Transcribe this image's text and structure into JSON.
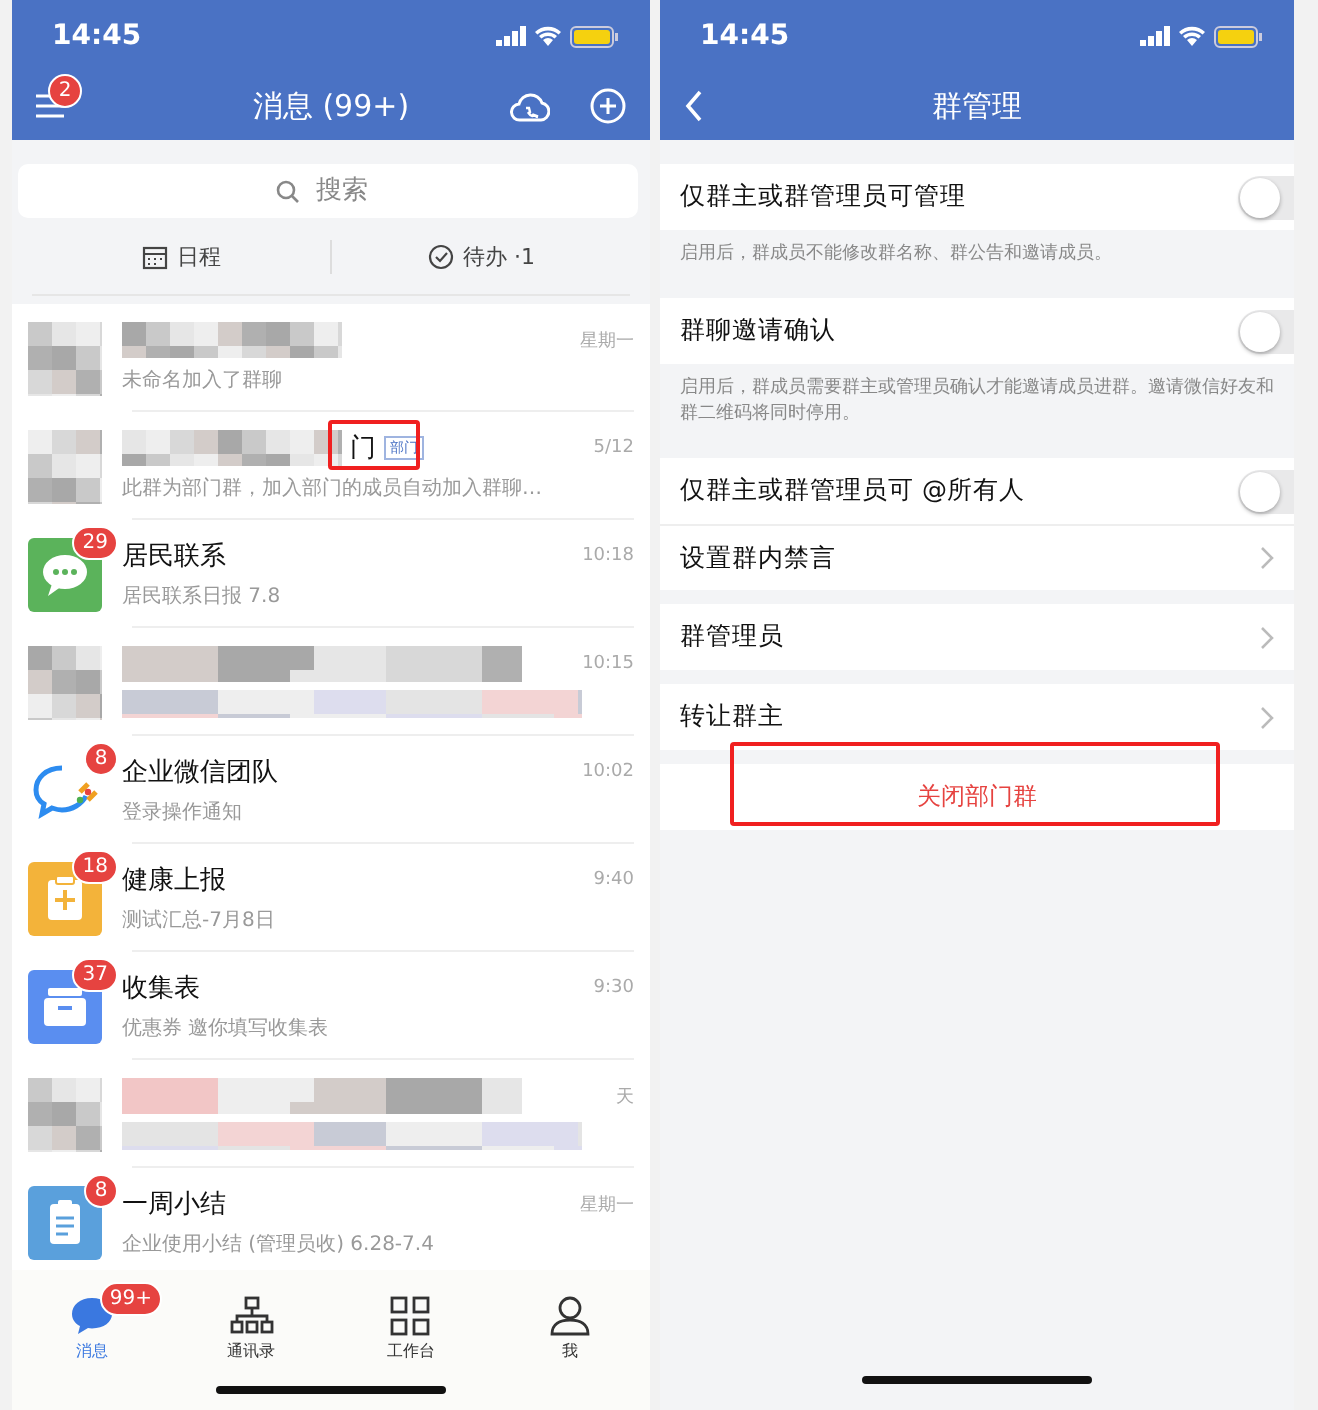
{
  "left_screen": {
    "status_bar": {
      "time": "14:45"
    },
    "header": {
      "title": "消息 (99+)",
      "menu_badge": "2"
    },
    "search": {
      "placeholder": "搜索"
    },
    "shortcuts": [
      {
        "kind": "calendar",
        "label": "日程"
      },
      {
        "kind": "check",
        "label": "待办 ·1"
      }
    ],
    "chats": [
      {
        "kind": "blurred",
        "preview": "未命名加入了群聊",
        "time": "星期一"
      },
      {
        "kind": "blurred",
        "name": "门",
        "tag": "部门",
        "highlighted": true,
        "preview": "此群为部门群，加入部门的成员自动加入群聊…",
        "time": "5/12"
      },
      {
        "kind": "chat",
        "name": "居民联系",
        "preview": "居民联系日报 7.8",
        "time": "10:18",
        "badge": "29"
      },
      {
        "kind": "blurred",
        "time": "10:15"
      },
      {
        "kind": "wecom",
        "name": "企业微信团队",
        "preview": "登录操作通知",
        "time": "10:02",
        "badge": "8"
      },
      {
        "kind": "health",
        "name": "健康上报",
        "preview": "测试汇总-7月8日",
        "time": "9:40",
        "badge": "18"
      },
      {
        "kind": "form",
        "name": "收集表",
        "preview": "优惠券 邀你填写收集表",
        "time": "9:30",
        "badge": "37"
      },
      {
        "kind": "blurred",
        "time": "天"
      },
      {
        "kind": "report",
        "name": "一周小结",
        "preview": "企业使用小结 (管理员收) 6.28-7.4",
        "time": "星期一",
        "badge": "8"
      }
    ],
    "tab_bar": [
      {
        "kind": "chat",
        "label": "消息",
        "badge": "99+",
        "selected": true
      },
      {
        "kind": "contacts",
        "label": "通讯录",
        "selected": false
      },
      {
        "kind": "apps",
        "label": "工作台",
        "selected": false
      },
      {
        "kind": "me",
        "label": "我",
        "selected": false
      }
    ]
  },
  "right_screen": {
    "status_bar": {
      "time": "14:45"
    },
    "header": {
      "title": "群管理"
    },
    "sections": [
      {
        "rows": [
          {
            "kind": "toggle",
            "label": "仅群主或群管理员可管理",
            "on": false
          }
        ],
        "note": "启用后，群成员不能修改群名称、群公告和邀请成员。"
      },
      {
        "rows": [
          {
            "kind": "toggle",
            "label": "群聊邀请确认",
            "on": false
          }
        ],
        "note": "启用后，群成员需要群主或管理员确认才能邀请成员进群。邀请微信好友和群二维码将同时停用。"
      },
      {
        "rows": [
          {
            "kind": "toggle",
            "label": "仅群主或群管理员可 @所有人",
            "on": false
          },
          {
            "kind": "link",
            "label": "设置群内禁言"
          }
        ]
      },
      {
        "rows": [
          {
            "kind": "link",
            "label": "群管理员"
          }
        ]
      },
      {
        "rows": [
          {
            "kind": "link",
            "label": "转让群主"
          }
        ]
      },
      {
        "rows": [
          {
            "kind": "action",
            "label": "关闭部门群",
            "highlighted": true
          }
        ]
      }
    ]
  }
}
